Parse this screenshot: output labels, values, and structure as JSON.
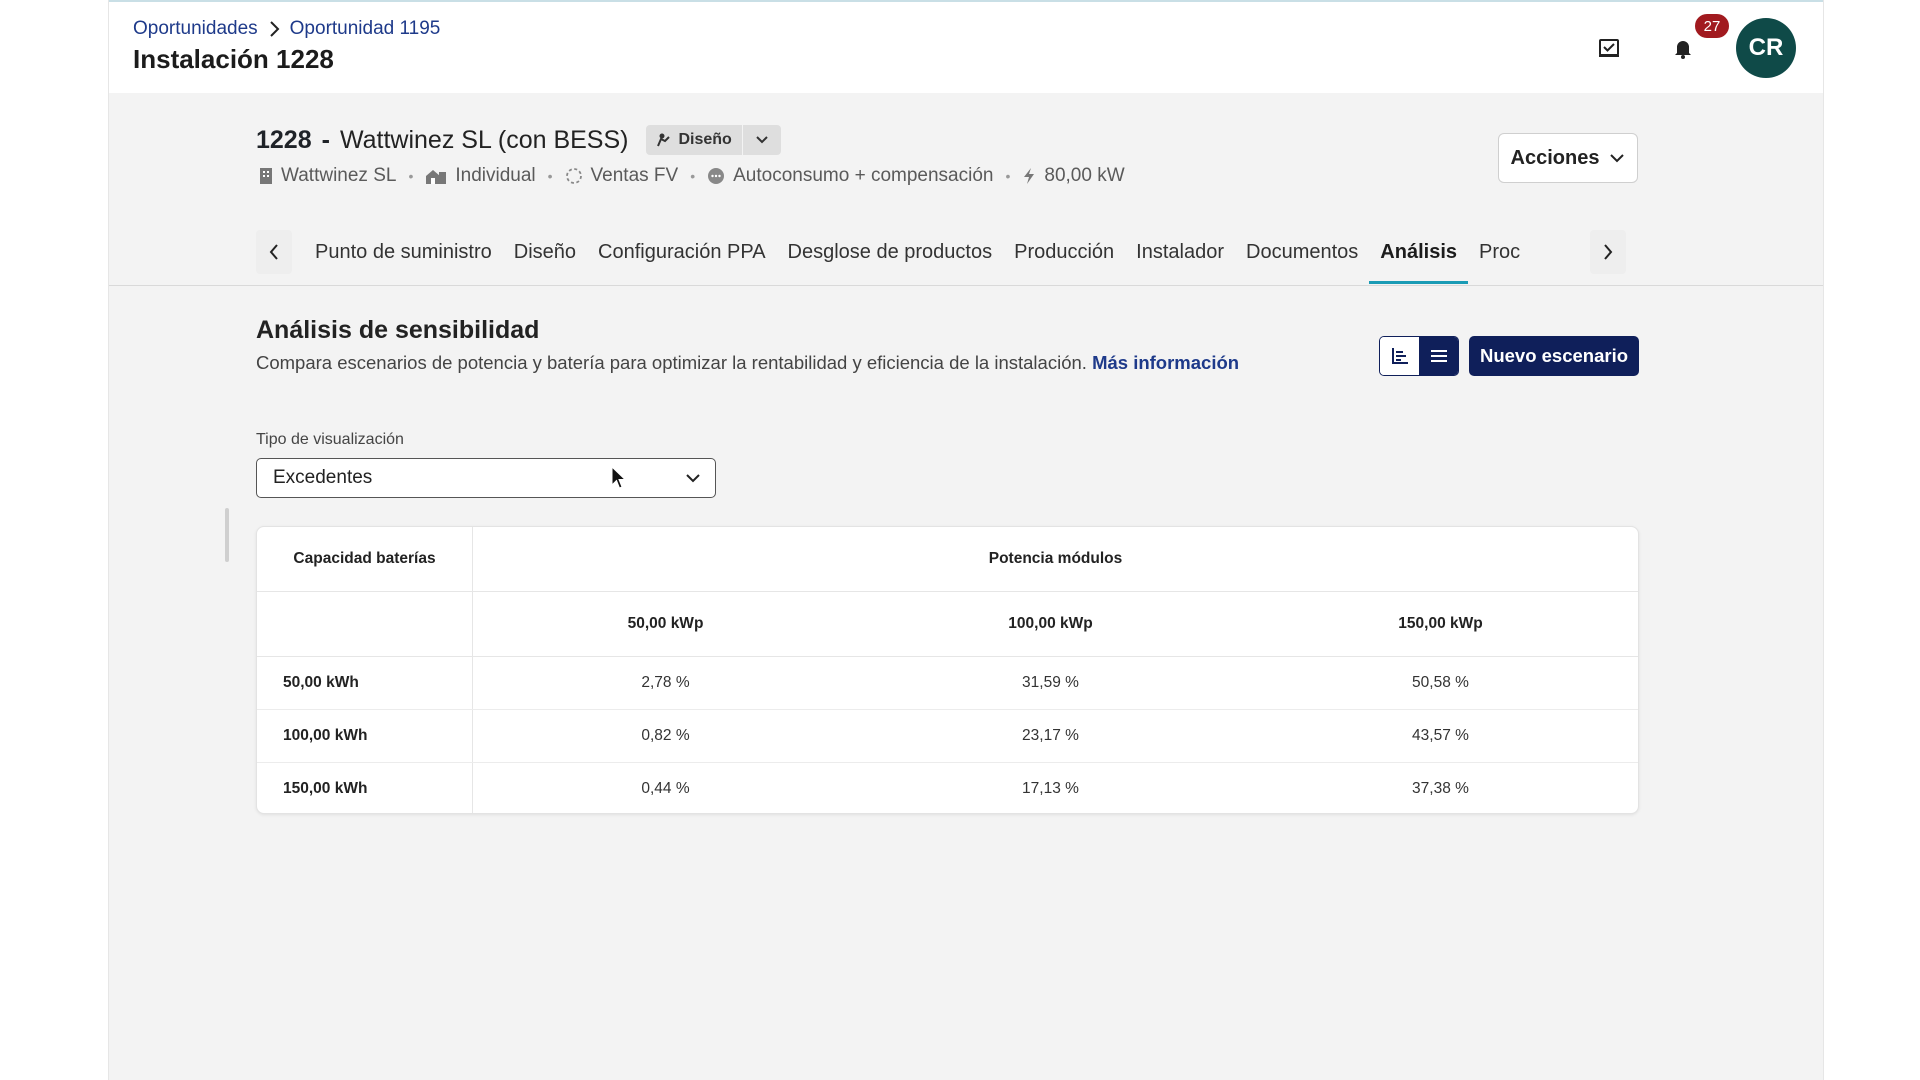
{
  "breadcrumb": {
    "items": [
      "Oportunidades",
      "Oportunidad 1195"
    ]
  },
  "page_title": "Instalación 1228",
  "notifications": {
    "count": "27"
  },
  "user": {
    "initials": "CR"
  },
  "installation": {
    "number": "1228",
    "dash": "-",
    "name": "Wattwinez SL (con BESS)",
    "status": "Diseño",
    "meta": {
      "client": "Wattwinez SL",
      "type": "Individual",
      "sale": "Ventas FV",
      "mode": "Autoconsumo + compensación",
      "power": "80,00 kW"
    }
  },
  "actions_label": "Acciones",
  "tabs": [
    {
      "label": "Punto de suministro"
    },
    {
      "label": "Diseño"
    },
    {
      "label": "Configuración PPA"
    },
    {
      "label": "Desglose de productos"
    },
    {
      "label": "Producción"
    },
    {
      "label": "Instalador"
    },
    {
      "label": "Documentos"
    },
    {
      "label": "Análisis"
    },
    {
      "label": "Proc"
    }
  ],
  "analysis": {
    "title": "Análisis de sensibilidad",
    "description": "Compara escenarios de potencia y batería para optimizar la rentabilidad y eficiencia de la instalación.",
    "more_info": "Más información",
    "new_scenario": "Nuevo escenario",
    "viz_label": "Tipo de visualización",
    "viz_value": "Excedentes"
  },
  "table": {
    "corner_header": "Capacidad baterías",
    "group_header": "Potencia módulos",
    "columns": [
      "50,00 kWp",
      "100,00 kWp",
      "150,00 kWp"
    ],
    "rows": [
      {
        "label": "50,00 kWh",
        "values": [
          "2,78 %",
          "31,59 %",
          "50,58 %"
        ]
      },
      {
        "label": "100,00 kWh",
        "values": [
          "0,82 %",
          "23,17 %",
          "43,57 %"
        ]
      },
      {
        "label": "150,00 kWh",
        "values": [
          "0,44 %",
          "17,13 %",
          "37,38 %"
        ]
      }
    ]
  }
}
